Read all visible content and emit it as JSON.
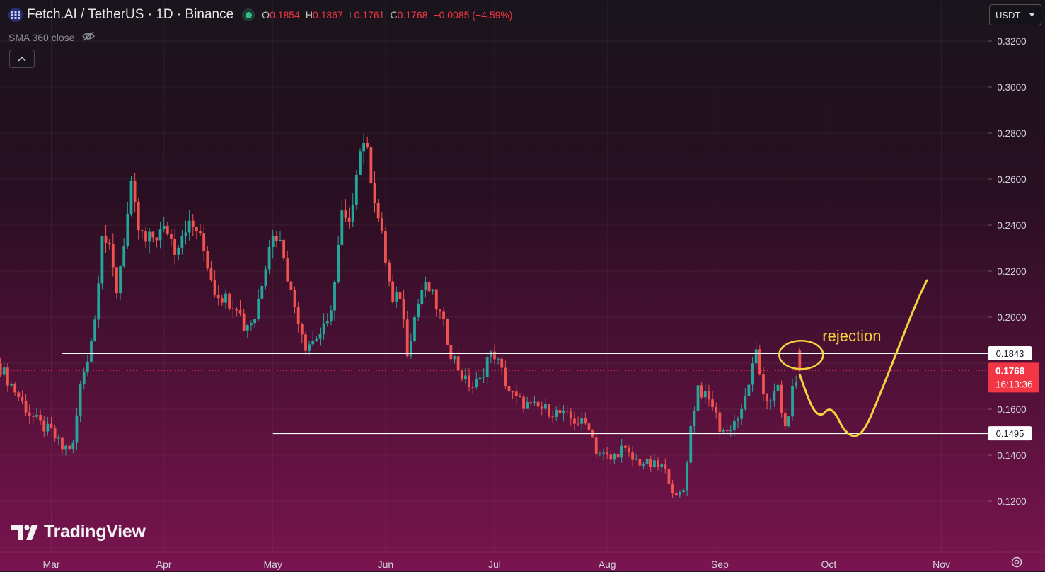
{
  "header": {
    "symbol_title": "Fetch.AI / TetherUS · 1D · Binance",
    "ohlc": [
      {
        "label": "O",
        "value": "0.1854"
      },
      {
        "label": "H",
        "value": "0.1867"
      },
      {
        "label": "L",
        "value": "0.1761"
      },
      {
        "label": "C",
        "value": "0.1768"
      },
      {
        "label": "",
        "value": "−0.0085 (−4.59%)"
      }
    ]
  },
  "indicator": {
    "label": "SMA 360 close"
  },
  "currency_selector": {
    "value": "USDT"
  },
  "branding": {
    "logo_text": "TradingView"
  },
  "colors": {
    "up": "#26a69a",
    "down": "#ef5350",
    "annotation": "#f7d23e",
    "price_tag": "#f23645"
  },
  "chart_data": {
    "type": "candlestick",
    "x_axis": {
      "months": [
        {
          "label": "Mar",
          "day": 0
        },
        {
          "label": "Apr",
          "day": 31
        },
        {
          "label": "May",
          "day": 61
        },
        {
          "label": "Jun",
          "day": 92
        },
        {
          "label": "Jul",
          "day": 122
        },
        {
          "label": "Aug",
          "day": 153
        },
        {
          "label": "Sep",
          "day": 184
        },
        {
          "label": "Oct",
          "day": 214
        },
        {
          "label": "Nov",
          "day": 245
        }
      ]
    },
    "y_axis": {
      "min": 0.1,
      "max": 0.3269,
      "ticks": [
        "0.3200",
        "0.3000",
        "0.2800",
        "0.2600",
        "0.2400",
        "0.2200",
        "0.2000",
        "0.1600",
        "0.1400",
        "0.1200"
      ]
    },
    "grid": true,
    "first_candle_day": -14,
    "close_path": [
      [
        -14,
        0.178
      ],
      [
        -10,
        0.168
      ],
      [
        -6,
        0.158
      ],
      [
        -2,
        0.152
      ],
      [
        0,
        0.15
      ],
      [
        3,
        0.143
      ],
      [
        6,
        0.144
      ],
      [
        8,
        0.17
      ],
      [
        10,
        0.183
      ],
      [
        12,
        0.199
      ],
      [
        14,
        0.238
      ],
      [
        16,
        0.228
      ],
      [
        18,
        0.212
      ],
      [
        22,
        0.255
      ],
      [
        24,
        0.238
      ],
      [
        26,
        0.232
      ],
      [
        28,
        0.235
      ],
      [
        32,
        0.238
      ],
      [
        34,
        0.23
      ],
      [
        37,
        0.24
      ],
      [
        40,
        0.238
      ],
      [
        42,
        0.229
      ],
      [
        45,
        0.212
      ],
      [
        48,
        0.208
      ],
      [
        51,
        0.206
      ],
      [
        53,
        0.196
      ],
      [
        56,
        0.2
      ],
      [
        58,
        0.216
      ],
      [
        60,
        0.233
      ],
      [
        62,
        0.236
      ],
      [
        64,
        0.228
      ],
      [
        66,
        0.21
      ],
      [
        68,
        0.2
      ],
      [
        70,
        0.188
      ],
      [
        72,
        0.19
      ],
      [
        76,
        0.196
      ],
      [
        78,
        0.215
      ],
      [
        80,
        0.244
      ],
      [
        82,
        0.238
      ],
      [
        84,
        0.266
      ],
      [
        86,
        0.278
      ],
      [
        88,
        0.262
      ],
      [
        90,
        0.243
      ],
      [
        92,
        0.225
      ],
      [
        94,
        0.205
      ],
      [
        96,
        0.21
      ],
      [
        98,
        0.186
      ],
      [
        100,
        0.2
      ],
      [
        102,
        0.212
      ],
      [
        104,
        0.212
      ],
      [
        106,
        0.205
      ],
      [
        108,
        0.196
      ],
      [
        110,
        0.185
      ],
      [
        112,
        0.178
      ],
      [
        114,
        0.172
      ],
      [
        116,
        0.17
      ],
      [
        118,
        0.172
      ],
      [
        120,
        0.182
      ],
      [
        122,
        0.184
      ],
      [
        124,
        0.176
      ],
      [
        126,
        0.168
      ],
      [
        128,
        0.164
      ],
      [
        132,
        0.161
      ],
      [
        136,
        0.16
      ],
      [
        140,
        0.158
      ],
      [
        144,
        0.155
      ],
      [
        148,
        0.153
      ],
      [
        150,
        0.142
      ],
      [
        154,
        0.138
      ],
      [
        157,
        0.143
      ],
      [
        160,
        0.138
      ],
      [
        164,
        0.136
      ],
      [
        168,
        0.135
      ],
      [
        170,
        0.13
      ],
      [
        172,
        0.121
      ],
      [
        174,
        0.125
      ],
      [
        176,
        0.152
      ],
      [
        178,
        0.17
      ],
      [
        180,
        0.165
      ],
      [
        182,
        0.162
      ],
      [
        184,
        0.152
      ],
      [
        186,
        0.15
      ],
      [
        188,
        0.155
      ],
      [
        190,
        0.158
      ],
      [
        192,
        0.172
      ],
      [
        194,
        0.183
      ],
      [
        196,
        0.168
      ],
      [
        198,
        0.162
      ],
      [
        200,
        0.17
      ],
      [
        202,
        0.15
      ],
      [
        204,
        0.168
      ],
      [
        206,
        0.1768
      ]
    ],
    "series": [
      {
        "name": "Fetch.AI / TetherUS",
        "last_open": 0.1854,
        "last_high": 0.1867,
        "last_low": 0.1761,
        "last_close": 0.1768
      }
    ],
    "horizontal_levels": [
      {
        "value": 0.1843,
        "label": "0.1843",
        "from_day": 3
      },
      {
        "value": 0.1495,
        "label": "0.1495",
        "from_day": 61
      }
    ],
    "price_tag": {
      "value": 0.1768,
      "label": "0.1768",
      "countdown": "16:13:36"
    },
    "annotation": {
      "text": "rejection",
      "projection_path": [
        [
          206,
          0.175
        ],
        [
          208,
          0.166
        ],
        [
          210,
          0.159
        ],
        [
          212,
          0.157
        ],
        [
          214,
          0.1605
        ],
        [
          216,
          0.158
        ],
        [
          218,
          0.151
        ],
        [
          221,
          0.1475
        ],
        [
          224,
          0.151
        ],
        [
          228,
          0.166
        ],
        [
          233,
          0.186
        ],
        [
          238,
          0.206
        ],
        [
          241,
          0.216
        ]
      ]
    }
  }
}
